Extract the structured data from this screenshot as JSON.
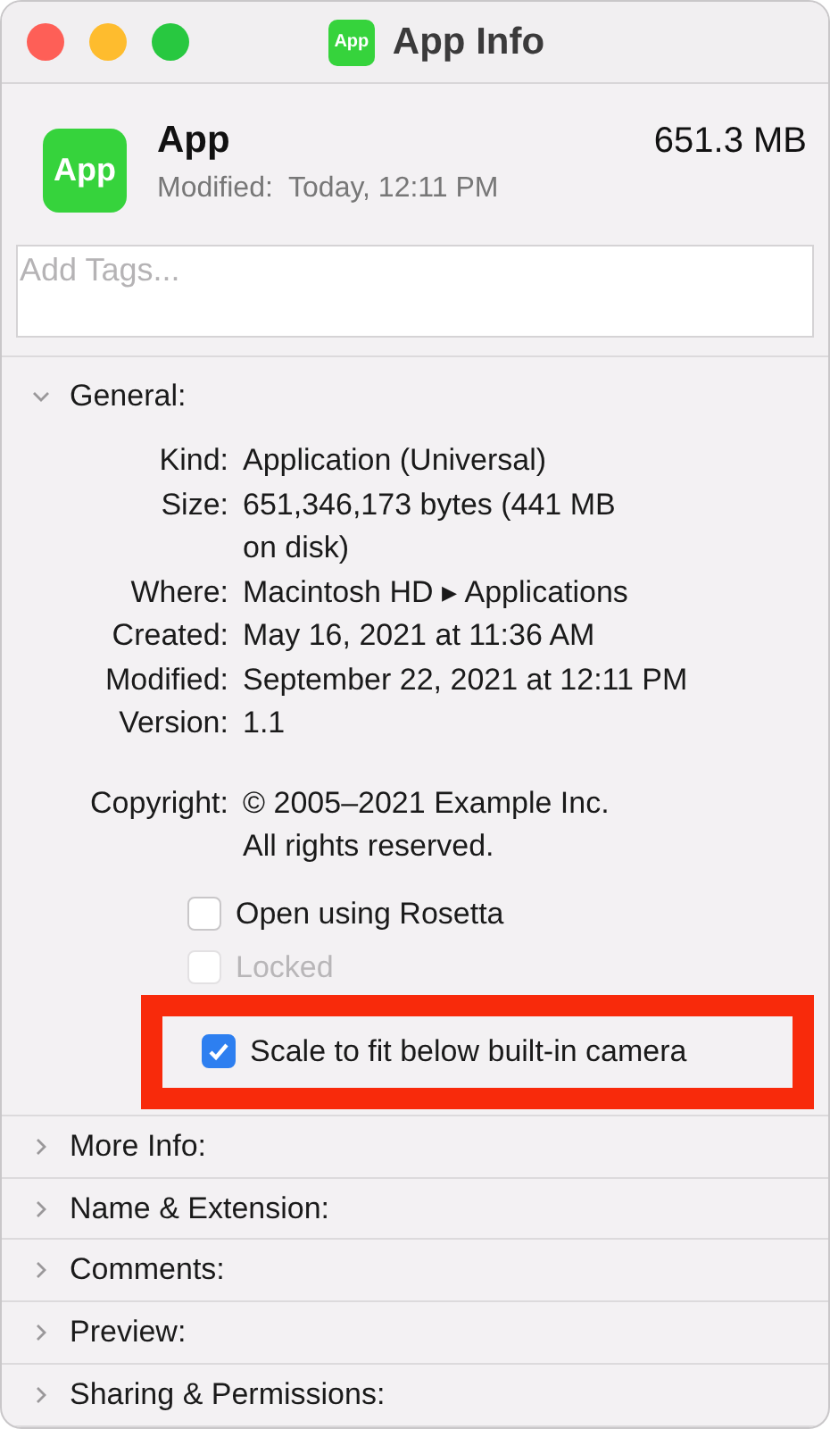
{
  "window": {
    "title": "App Info",
    "app_icon_label": "App"
  },
  "header": {
    "icon_label": "App",
    "name": "App",
    "size": "651.3 MB",
    "modified": "Modified:  Today, 12:11 PM"
  },
  "tags": {
    "placeholder": "Add Tags..."
  },
  "general": {
    "title": "General:",
    "expanded": true,
    "fields": [
      {
        "label": "Kind:",
        "lines": [
          "Application (Universal)"
        ]
      },
      {
        "label": "Size:",
        "lines": [
          "651,346,173 bytes (441 MB",
          "on disk)"
        ]
      },
      {
        "label": "Where:",
        "lines": [
          "Macintosh HD ▸ Applications"
        ]
      },
      {
        "label": "Created:",
        "lines": [
          "May 16, 2021 at 11:36 AM"
        ]
      },
      {
        "label": "Modified:",
        "lines": [
          "September 22, 2021 at 12:11 PM"
        ]
      },
      {
        "label": "Version:",
        "lines": [
          "1.1"
        ]
      },
      {
        "label": "Copyright:",
        "lines": [
          "© 2005–2021 Example Inc.",
          "All rights reserved."
        ],
        "gap": true
      }
    ],
    "checkboxes": [
      {
        "label": "Open using Rosetta",
        "checked": false,
        "disabled": false,
        "highlighted": false
      },
      {
        "label": "Locked",
        "checked": false,
        "disabled": true,
        "highlighted": false
      },
      {
        "label": "Scale to fit below built-in camera",
        "checked": true,
        "disabled": false,
        "highlighted": true
      }
    ]
  },
  "sections": [
    {
      "title": "More Info:",
      "expanded": false
    },
    {
      "title": "Name & Extension:",
      "expanded": false
    },
    {
      "title": "Comments:",
      "expanded": false
    },
    {
      "title": "Preview:",
      "expanded": false
    },
    {
      "title": "Sharing & Permissions:",
      "expanded": false
    }
  ]
}
